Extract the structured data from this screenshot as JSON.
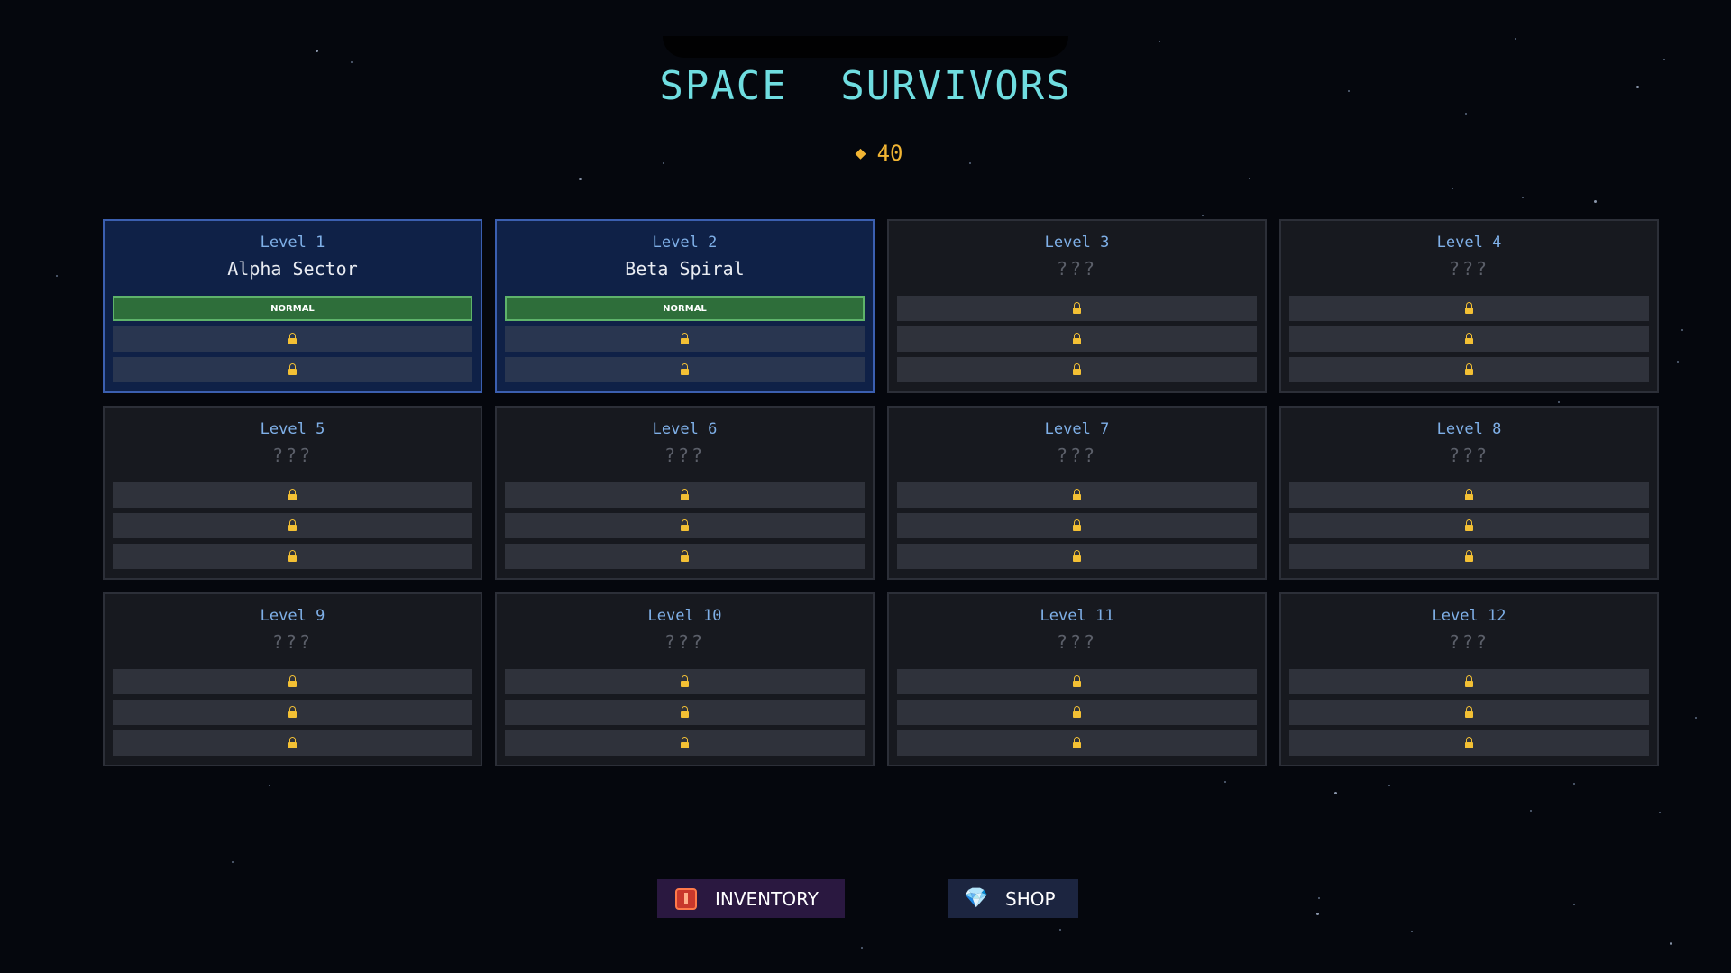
{
  "header": {
    "title": "SPACE SURVIVORS",
    "currency_icon": "diamond-icon",
    "currency": "40"
  },
  "levels": [
    {
      "label": "Level 1",
      "name": "Alpha Sector",
      "unlocked": true,
      "difficulties": [
        "NORMAL",
        "locked",
        "locked"
      ]
    },
    {
      "label": "Level 2",
      "name": "Beta Spiral",
      "unlocked": true,
      "difficulties": [
        "NORMAL",
        "locked",
        "locked"
      ]
    },
    {
      "label": "Level 3",
      "name": "???",
      "unlocked": false,
      "difficulties": [
        "locked",
        "locked",
        "locked"
      ]
    },
    {
      "label": "Level 4",
      "name": "???",
      "unlocked": false,
      "difficulties": [
        "locked",
        "locked",
        "locked"
      ]
    },
    {
      "label": "Level 5",
      "name": "???",
      "unlocked": false,
      "difficulties": [
        "locked",
        "locked",
        "locked"
      ]
    },
    {
      "label": "Level 6",
      "name": "???",
      "unlocked": false,
      "difficulties": [
        "locked",
        "locked",
        "locked"
      ]
    },
    {
      "label": "Level 7",
      "name": "???",
      "unlocked": false,
      "difficulties": [
        "locked",
        "locked",
        "locked"
      ]
    },
    {
      "label": "Level 8",
      "name": "???",
      "unlocked": false,
      "difficulties": [
        "locked",
        "locked",
        "locked"
      ]
    },
    {
      "label": "Level 9",
      "name": "???",
      "unlocked": false,
      "difficulties": [
        "locked",
        "locked",
        "locked"
      ]
    },
    {
      "label": "Level 10",
      "name": "???",
      "unlocked": false,
      "difficulties": [
        "locked",
        "locked",
        "locked"
      ]
    },
    {
      "label": "Level 11",
      "name": "???",
      "unlocked": false,
      "difficulties": [
        "locked",
        "locked",
        "locked"
      ]
    },
    {
      "label": "Level 12",
      "name": "???",
      "unlocked": false,
      "difficulties": [
        "locked",
        "locked",
        "locked"
      ]
    }
  ],
  "footer": {
    "inventory": {
      "label": "INVENTORY",
      "icon": "chest-icon"
    },
    "shop": {
      "label": "SHOP",
      "icon": "diamond-icon"
    }
  },
  "colors": {
    "accent": "#6fdde0",
    "currency": "#f2b533",
    "unlocked_card": "#0f2147",
    "difficulty_open": "#2e6e3a"
  }
}
